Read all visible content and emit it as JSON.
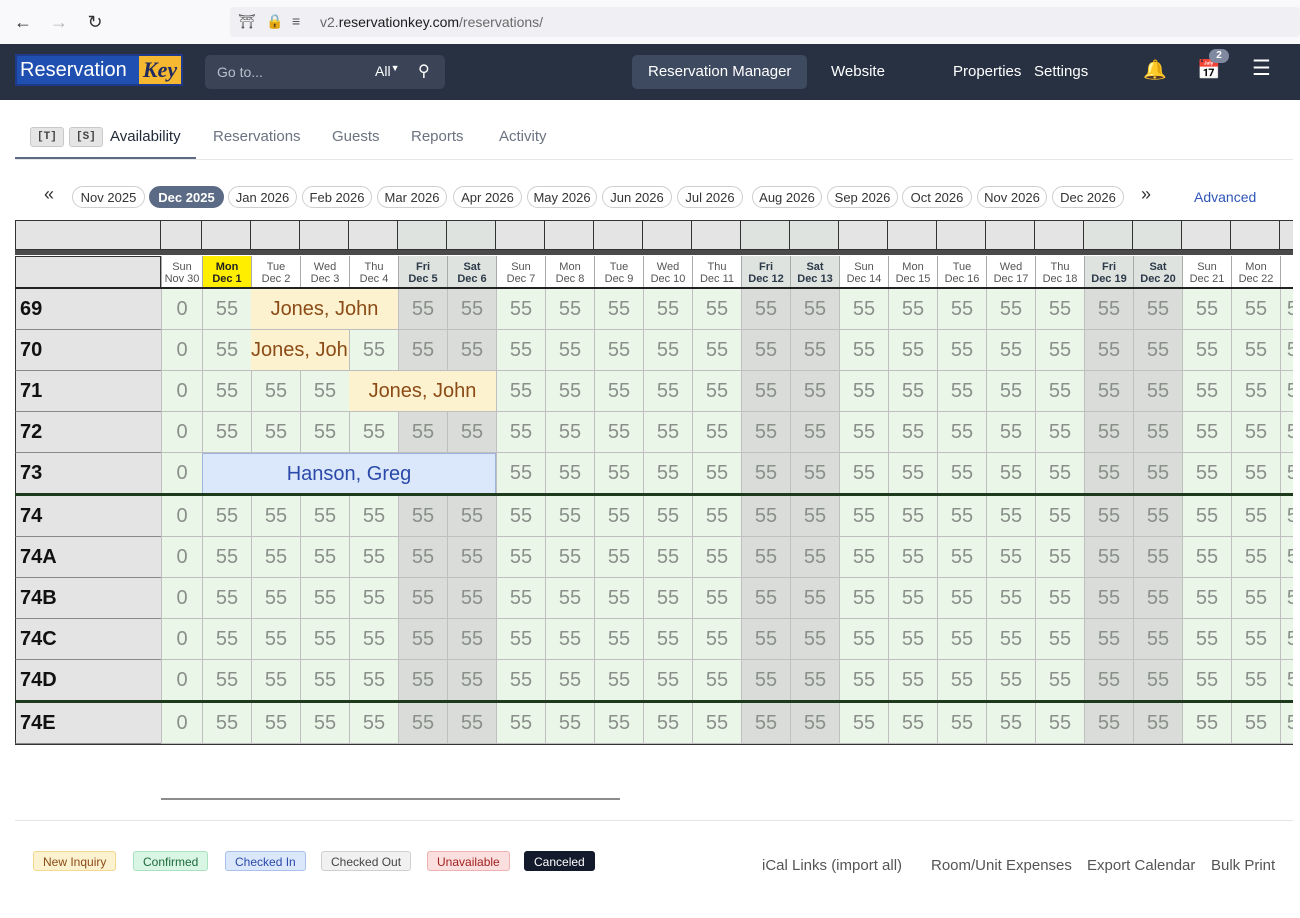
{
  "browser": {
    "url_prefix": "v2.",
    "url_domain": "reservationkey.com",
    "url_path": "/reservations/"
  },
  "header": {
    "logo_part1": "Reservation",
    "logo_part2": "Key",
    "search_placeholder": "Go to...",
    "search_scope": "All",
    "nav": [
      "Reservation Manager",
      "Website",
      "Properties",
      "Settings"
    ],
    "cart_count": "2"
  },
  "subtabs": {
    "kbd_t": "[T]",
    "kbd_s": "[S]",
    "items": [
      "Availability",
      "Reservations",
      "Guests",
      "Reports",
      "Activity"
    ]
  },
  "months": {
    "prev": "«",
    "next": "»",
    "items": [
      "Nov 2025",
      "Dec 2025",
      "Jan 2026",
      "Feb 2026",
      "Mar 2026",
      "Apr 2026",
      "May 2026",
      "Jun 2026",
      "Jul 2026",
      "Aug 2026",
      "Sep 2026",
      "Oct 2026",
      "Nov 2026",
      "Dec 2026"
    ],
    "active": "Dec 2025",
    "advanced": "Advanced"
  },
  "grid": {
    "days": [
      {
        "dow": "Sun",
        "date": "Nov 30"
      },
      {
        "dow": "Mon",
        "date": "Dec 1",
        "today": true
      },
      {
        "dow": "Tue",
        "date": "Dec 2"
      },
      {
        "dow": "Wed",
        "date": "Dec 3"
      },
      {
        "dow": "Thu",
        "date": "Dec 4"
      },
      {
        "dow": "Fri",
        "date": "Dec 5",
        "weekend": true
      },
      {
        "dow": "Sat",
        "date": "Dec 6",
        "weekend": true
      },
      {
        "dow": "Sun",
        "date": "Dec 7"
      },
      {
        "dow": "Mon",
        "date": "Dec 8"
      },
      {
        "dow": "Tue",
        "date": "Dec 9"
      },
      {
        "dow": "Wed",
        "date": "Dec 10"
      },
      {
        "dow": "Thu",
        "date": "Dec 11"
      },
      {
        "dow": "Fri",
        "date": "Dec 12",
        "weekend": true
      },
      {
        "dow": "Sat",
        "date": "Dec 13",
        "weekend": true
      },
      {
        "dow": "Sun",
        "date": "Dec 14"
      },
      {
        "dow": "Mon",
        "date": "Dec 15"
      },
      {
        "dow": "Tue",
        "date": "Dec 16"
      },
      {
        "dow": "Wed",
        "date": "Dec 17"
      },
      {
        "dow": "Thu",
        "date": "Dec 18"
      },
      {
        "dow": "Fri",
        "date": "Dec 19",
        "weekend": true
      },
      {
        "dow": "Sat",
        "date": "Dec 20",
        "weekend": true
      },
      {
        "dow": "Sun",
        "date": "Dec 21"
      },
      {
        "dow": "Mon",
        "date": "Dec 22"
      },
      {
        "dow": "",
        "date": "D"
      }
    ],
    "first_day_value": "0",
    "rate": "55",
    "rooms": [
      "69",
      "70",
      "71",
      "72",
      "73",
      "74",
      "74A",
      "74B",
      "74C",
      "74D",
      "74E"
    ],
    "reservations": [
      {
        "room": "69",
        "start": 2,
        "end": 5,
        "label": "Jones, John",
        "status": "inquiry"
      },
      {
        "room": "70",
        "start": 2,
        "end": 4,
        "label": "Jones, John",
        "status": "inquiry"
      },
      {
        "room": "71",
        "start": 4,
        "end": 7,
        "label": "Jones, John",
        "status": "inquiry"
      },
      {
        "room": "73",
        "start": 1,
        "end": 7,
        "label": "Hanson, Greg",
        "status": "checkedin"
      }
    ]
  },
  "legend": [
    {
      "label": "New Inquiry",
      "bg": "#fdf2cf",
      "fg": "#8a4b16",
      "border": "#f2d98e"
    },
    {
      "label": "Confirmed",
      "bg": "#d9f5e3",
      "fg": "#1d6b3b",
      "border": "#a9e0bd"
    },
    {
      "label": "Checked In",
      "bg": "#dbe8fb",
      "fg": "#2a49a8",
      "border": "#a9c0ea"
    },
    {
      "label": "Checked Out",
      "bg": "#f1f1f1",
      "fg": "#444444",
      "border": "#cfcfcf"
    },
    {
      "label": "Unavailable",
      "bg": "#fbdede",
      "fg": "#a32020",
      "border": "#efb2b2"
    },
    {
      "label": "Canceled",
      "bg": "#121a2b",
      "fg": "#ffffff",
      "border": "#121a2b"
    }
  ],
  "footer_links": [
    "iCal Links (import all)",
    "Room/Unit Expenses",
    "Export Calendar",
    "Bulk Print"
  ]
}
